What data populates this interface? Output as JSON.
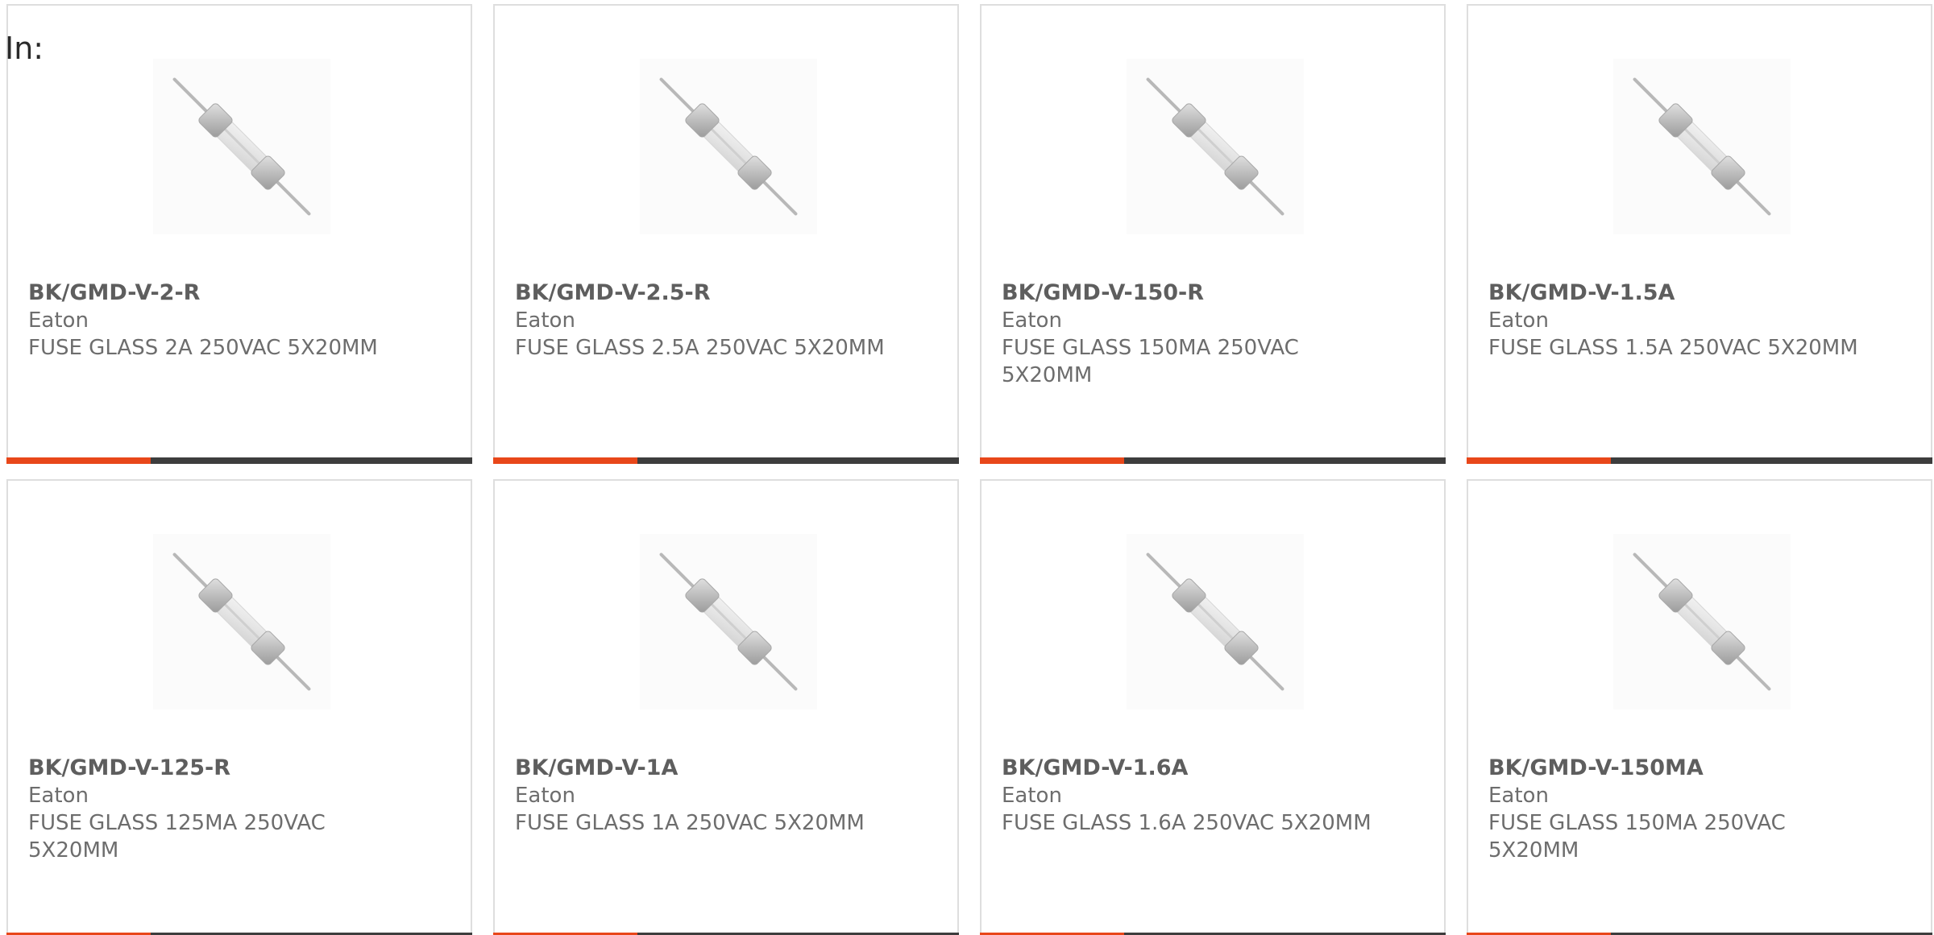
{
  "header": {
    "in_label": "In:"
  },
  "colors": {
    "accent": "#e8471a",
    "bar": "#3d3d3d",
    "border": "#dedede",
    "text": "#6d6d6d"
  },
  "card_bar_accent_fraction": 0.31,
  "product_icon": "glass-fuse-icon",
  "products": [
    {
      "part": "BK/GMD-V-2-R",
      "brand": "Eaton",
      "description": "FUSE GLASS 2A 250VAC 5X20MM"
    },
    {
      "part": "BK/GMD-V-2.5-R",
      "brand": "Eaton",
      "description": "FUSE GLASS 2.5A 250VAC 5X20MM"
    },
    {
      "part": "BK/GMD-V-150-R",
      "brand": "Eaton",
      "description": "FUSE GLASS 150MA 250VAC 5X20MM"
    },
    {
      "part": "BK/GMD-V-1.5A",
      "brand": "Eaton",
      "description": "FUSE GLASS 1.5A 250VAC 5X20MM"
    },
    {
      "part": "BK/GMD-V-125-R",
      "brand": "Eaton",
      "description": "FUSE GLASS 125MA 250VAC 5X20MM"
    },
    {
      "part": "BK/GMD-V-1A",
      "brand": "Eaton",
      "description": "FUSE GLASS 1A 250VAC 5X20MM"
    },
    {
      "part": "BK/GMD-V-1.6A",
      "brand": "Eaton",
      "description": "FUSE GLASS 1.6A 250VAC 5X20MM"
    },
    {
      "part": "BK/GMD-V-150MA",
      "brand": "Eaton",
      "description": "FUSE GLASS 150MA 250VAC 5X20MM"
    }
  ]
}
